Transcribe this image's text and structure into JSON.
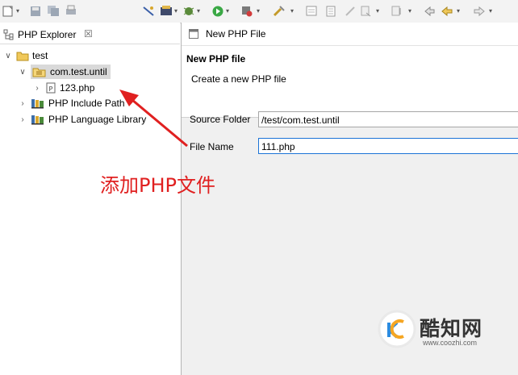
{
  "explorer": {
    "tab_label": "PHP Explorer",
    "tab_close": "☒",
    "tree": {
      "project": "test",
      "package": "com.test.until",
      "file": "123.php",
      "include_path": "PHP Include Path",
      "language_library": "PHP Language Library"
    }
  },
  "annotation": {
    "text": "添加PHP文件",
    "color": "#e02020"
  },
  "dialog": {
    "title": "New PHP File",
    "header_title": "New PHP file",
    "header_description": "Create a new PHP file",
    "source_folder_label": "Source Folder",
    "source_folder_value": "/test/com.test.until",
    "file_name_label": "File Name",
    "file_name_value": "111.php"
  },
  "watermark": {
    "name": "酷知网",
    "url": "www.coozhi.com"
  },
  "colors": {
    "accent": "#1b73d6",
    "annotation": "#e02020",
    "dialog_bg": "#f0f0f0"
  }
}
